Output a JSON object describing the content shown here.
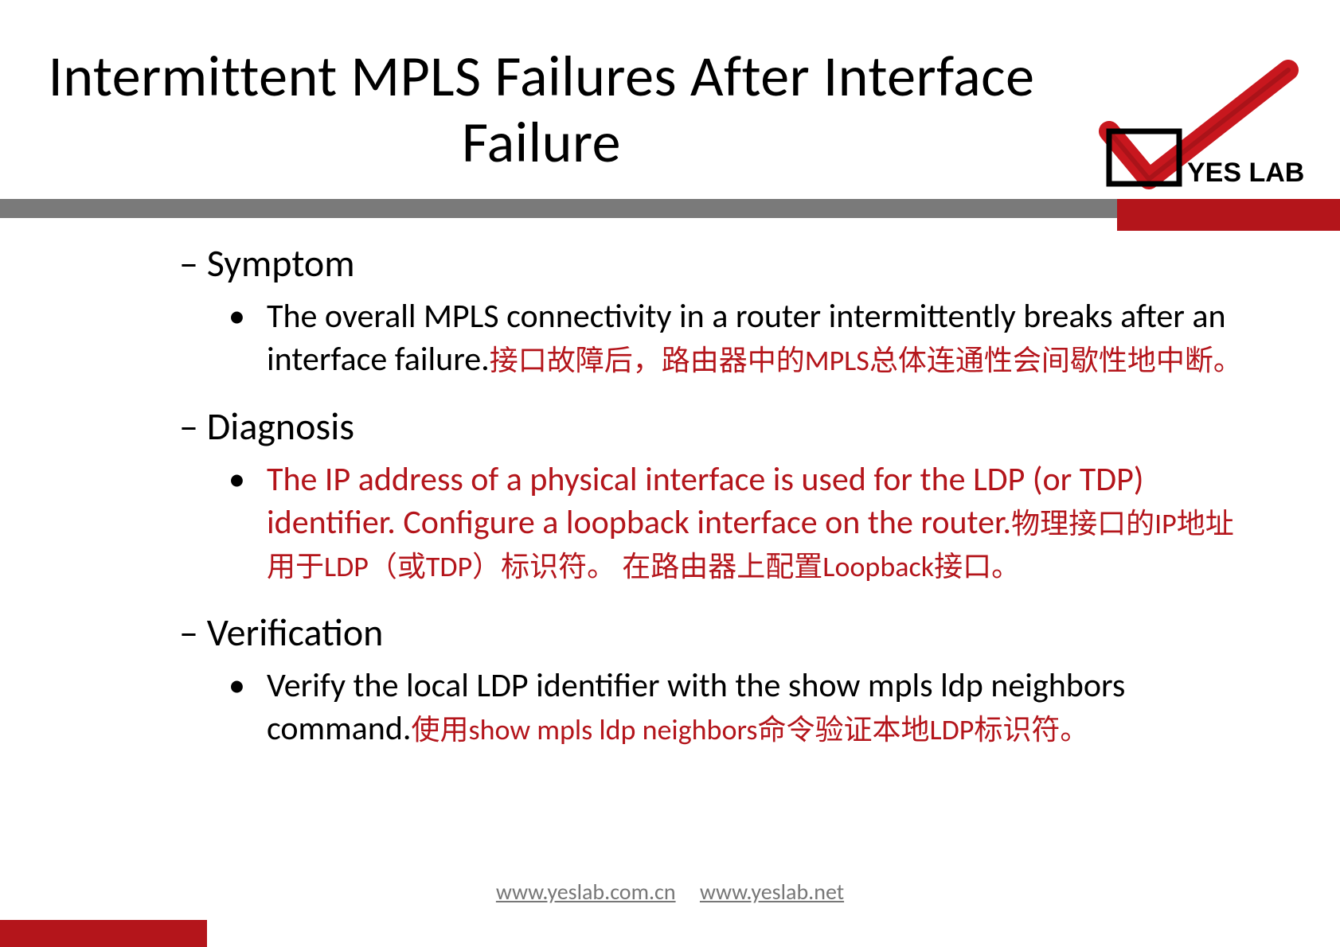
{
  "title": "Intermittent MPLS Failures After Interface Failure",
  "logo_text": "YES LAB",
  "sections": {
    "symptom": {
      "head": "Symptom",
      "en": "The overall MPLS connectivity in a router intermittently breaks after an interface failure.",
      "zh": "接口故障后，路由器中的MPLS总体连通性会间歇性地中断。"
    },
    "diagnosis": {
      "head": "Diagnosis",
      "en": "The IP address of a physical interface is used for the LDP (or TDP) identifier. Configure a loopback interface on the router.",
      "zh": "物理接口的IP地址用于LDP（或TDP）标识符。 在路由器上配置Loopback接口。"
    },
    "verification": {
      "head": "Verification",
      "en_pre": "Verify the local LDP identifier with the ",
      "en_cmd": "show mpls ldp neighbors",
      "en_post": " command.",
      "zh": "使用show mpls ldp neighbors命令验证本地LDP标识符。"
    }
  },
  "footer": {
    "link1": "www.yeslab.com.cn",
    "link2": "www.yeslab.net"
  },
  "colors": {
    "brand_red": "#b4151b",
    "divider_gray": "#7a7a7a"
  }
}
